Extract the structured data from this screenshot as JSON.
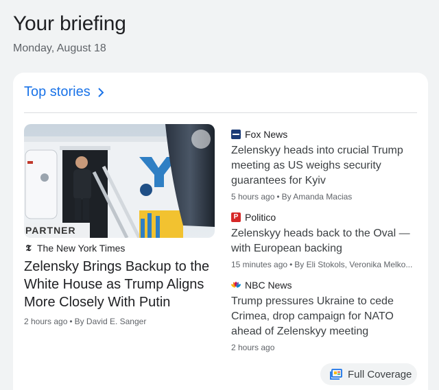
{
  "briefing": {
    "title": "Your briefing",
    "date": "Monday, August 18"
  },
  "section": {
    "title": "Top stories",
    "chevron_icon": "chevron-right-icon"
  },
  "hero": {
    "image_icon": "zelensky-plane-photo",
    "image_lettering": "PARTNER",
    "source": "The New York Times",
    "source_icon": "nyt-logo-icon",
    "headline": "Zelensky Brings Backup to the White House as Trump Aligns More Closely With Putin",
    "time": "2 hours ago",
    "byline": "By David E. Sanger"
  },
  "stories": [
    {
      "source": "Fox News",
      "source_icon": "fox-news-logo-icon",
      "headline": "Zelenskyy heads into crucial Trump meeting as US weighs security guarantees for Kyiv",
      "time": "5 hours ago",
      "byline": "By Amanda Macias"
    },
    {
      "source": "Politico",
      "source_icon": "politico-logo-icon",
      "headline": "Zelenskyy heads back to the Oval — with European backing",
      "time": "15 minutes ago",
      "byline": "By Eli Stokols, Veronika Melko..."
    },
    {
      "source": "NBC News",
      "source_icon": "nbc-peacock-logo-icon",
      "headline": "Trump pressures Ukraine to cede Crimea, drop campaign for NATO ahead of Zelenskyy meeting",
      "time": "2 hours ago",
      "byline": ""
    }
  ],
  "full_coverage": {
    "label": "Full Coverage",
    "icon": "full-coverage-icon"
  },
  "colors": {
    "accent": "#1a73e8",
    "background": "#f1f3f4",
    "card": "#ffffff",
    "text_secondary": "#5f6368"
  }
}
